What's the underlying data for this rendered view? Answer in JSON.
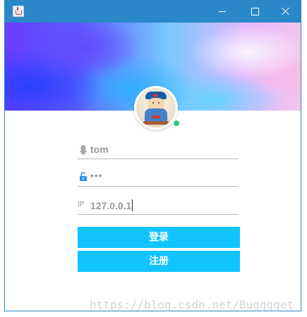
{
  "window": {
    "title": "",
    "controls": {
      "minimize": "minimize",
      "maximize": "maximize",
      "close": "close"
    }
  },
  "colors": {
    "titlebar": "#2a88c9",
    "button": "#12c4ff",
    "status_online": "#22d27a"
  },
  "form": {
    "username": "tom",
    "password_mask": "•••",
    "ip_label": "IP",
    "ip_value": "127.0.0.1"
  },
  "buttons": {
    "login": "登录",
    "register": "注册"
  },
  "watermark": "https://blog.csdn.net/Bugggget"
}
